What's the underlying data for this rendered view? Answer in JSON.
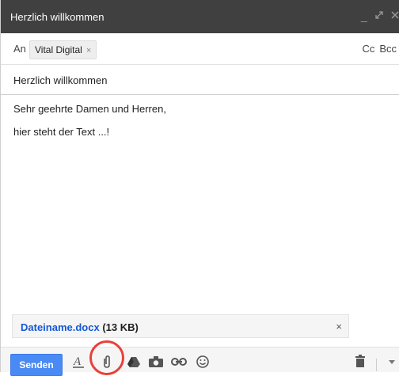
{
  "window": {
    "title": "Herzlich willkommen"
  },
  "recipients": {
    "to_label": "An",
    "chips": [
      {
        "name": "Vital Digital",
        "remove_glyph": "×"
      }
    ],
    "cc_label": "Cc",
    "bcc_label": "Bcc"
  },
  "subject": "Herzlich willkommen",
  "body": {
    "lines": [
      "Sehr geehrte Damen und Herren,",
      "hier steht der Text ...!"
    ]
  },
  "attachment": {
    "filename": "Dateiname.docx",
    "size": "(13 KB)",
    "remove_glyph": "×"
  },
  "toolbar": {
    "send_label": "Senden",
    "icons": [
      "format-text-icon",
      "attach-file-icon",
      "drive-icon",
      "photo-icon",
      "link-icon",
      "emoji-icon",
      "trash-icon",
      "more-options-icon"
    ]
  },
  "colors": {
    "titlebar": "#404040",
    "send_button": "#4a8af4",
    "attachment_link": "#1558d6",
    "highlight": "#e8403a"
  }
}
